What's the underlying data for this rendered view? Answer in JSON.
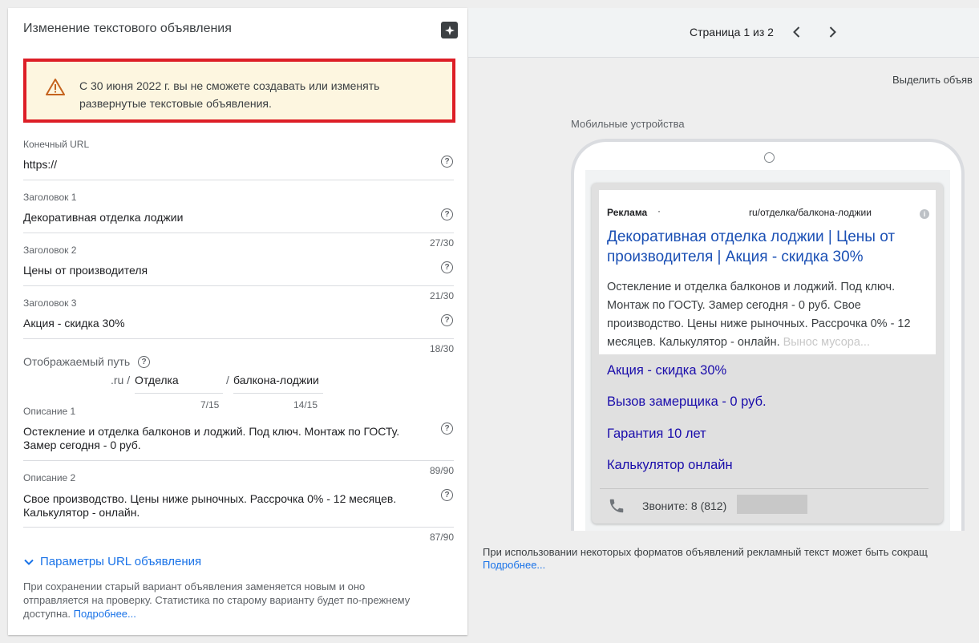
{
  "left_panel": {
    "title": "Изменение текстового объявления",
    "warning_text": "С 30 июня 2022 г. вы не сможете создавать или изменять развернутые текстовые объявления.",
    "fields": {
      "final_url": {
        "label": "Конечный URL",
        "value": "https://"
      },
      "headline1": {
        "label": "Заголовок 1",
        "value": "Декоративная отделка лоджии",
        "count": "27/30"
      },
      "headline2": {
        "label": "Заголовок 2",
        "value": "Цены от производителя",
        "count": "21/30"
      },
      "headline3": {
        "label": "Заголовок 3",
        "value": "Акция - скидка 30%",
        "count": "18/30"
      },
      "description1": {
        "label": "Описание 1",
        "value": "Остекление и отделка балконов и лоджий. Под ключ. Монтаж по ГОСТу. Замер сегодня - 0 руб.",
        "count": "89/90"
      },
      "description2": {
        "label": "Описание 2",
        "value": "Свое производство. Цены ниже рыночных. Рассрочка 0% - 12 месяцев. Калькулятор - онлайн.",
        "count": "87/90"
      }
    },
    "display_path": {
      "label": "Отображаемый путь",
      "domain": ".ru /",
      "path1": "Отделка",
      "separator": "/",
      "path2": "балкона-лоджии",
      "path1_count": "7/15",
      "path2_count": "14/15"
    },
    "url_params_label": "Параметры URL объявления",
    "save_note": "При сохранении старый вариант объявления заменяется новым и оно отправляется на проверку. Статистика по старому варианту будет по-прежнему доступна.",
    "save_note_link": "Подробнее..."
  },
  "preview": {
    "page_indicator": "Страница 1 из 2",
    "highlight_label": "Выделить объяв",
    "device_label": "Мобильные устройства",
    "ad": {
      "label": "Реклама",
      "dot": "·",
      "display_url": "ru/отделка/балкона-лоджии",
      "headline": "Декоративная отделка лоджии | Цены от производителя | Акция - скидка 30%",
      "description": "Остекление и отделка балконов и лоджий. Под ключ. Монтаж по ГОСТу. Замер сегодня - 0 руб. Свое производство. Цены ниже рыночных. Рассрочка 0% - 12 месяцев. Калькулятор - онлайн.",
      "description_fade": "Вынос мусора...",
      "sitelinks": [
        "Акция - скидка 30%",
        "Вызов замерщика - 0 руб.",
        "Гарантия 10 лет",
        "Калькулятор онлайн"
      ],
      "call_text": "Звоните: 8 (812)"
    },
    "footnote": "При использовании некоторых форматов объявлений рекламный текст может быть сокращ",
    "footnote_link": "Подробнее..."
  },
  "colors": {
    "warning_border": "#dd1e26",
    "warning_bg": "#fdf6e0",
    "link": "#1a73e8",
    "ad_headline": "#1a4fb4"
  }
}
